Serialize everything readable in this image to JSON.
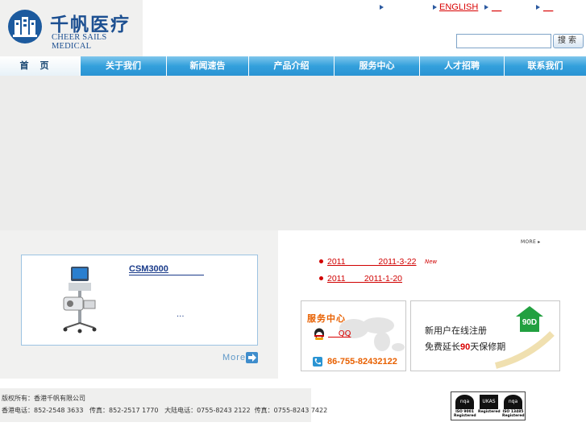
{
  "logo": {
    "cn": "千帆医疗",
    "en": "CHEER SAILS MEDICAL"
  },
  "top_links": {
    "english": "ENGLISH",
    "link2": "__",
    "link3": "__"
  },
  "search": {
    "button": "搜索",
    "placeholder": ""
  },
  "nav": [
    "首页",
    "关于我们",
    "新闻速告",
    "产品介绍",
    "服务中心",
    "人才招聘",
    "联系我们"
  ],
  "product": {
    "title": "CSM3000",
    "ellipsis": "...",
    "more": "More"
  },
  "news": {
    "more": "MORE",
    "items": [
      {
        "text": "2011              2011-3-22",
        "badge": "New"
      },
      {
        "text": "2011        2011-1-20"
      }
    ]
  },
  "service": {
    "title": "服务中心",
    "qq": "    QQ",
    "phone": "86-755-82432122"
  },
  "warranty": {
    "line1": "新用户在线注册",
    "line2_prefix": "免费延长",
    "line2_num": "90",
    "line2_suffix": "天保修期",
    "badge": "90D"
  },
  "footer": {
    "line1": "版权所有：香港千帆有限公司",
    "line2": "香港电话：852-2548 3633   传真：852-2517 1770   大陆电话：0755-8243 2122  传真：0755-8243 7422"
  },
  "certs": [
    {
      "top": "nqa",
      "bottom": "ISO 9001\nRegistered"
    },
    {
      "top": "UKAS",
      "bottom": "Registered"
    },
    {
      "top": "nqa",
      "bottom": "ISO 13485\nRegistered"
    }
  ],
  "colors": {
    "nav": "#33a0dc",
    "accent_red": "#d00000",
    "service_orange": "#e86000",
    "brand_blue": "#1c4f91"
  }
}
